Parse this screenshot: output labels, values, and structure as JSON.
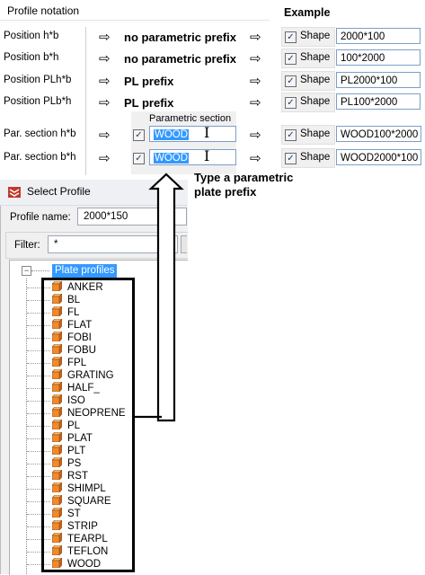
{
  "header": {
    "profile_notation": "Profile notation",
    "example": "Example"
  },
  "rows": [
    {
      "label": "Position h*b",
      "prefix": "no parametric prefix",
      "shape": "Shape",
      "value": "2000*100"
    },
    {
      "label": "Position b*h",
      "prefix": "no parametric prefix",
      "shape": "Shape",
      "value": "100*2000"
    },
    {
      "label": "Position PLh*b",
      "prefix": "PL prefix",
      "shape": "Shape",
      "value": "PL2000*100"
    },
    {
      "label": "Position PLb*h",
      "prefix": "PL prefix",
      "shape": "Shape",
      "value": "PL100*2000"
    },
    {
      "label": "Par. section h*b",
      "param": "WOOD",
      "shape": "Shape",
      "value": "WOOD100*2000"
    },
    {
      "label": "Par. section b*h",
      "param": "WOOD",
      "shape": "Shape",
      "value": "WOOD2000*100"
    }
  ],
  "parametric_section_title": "Parametric section",
  "callout": {
    "line1": "Type a parametric",
    "line2": "plate prefix"
  },
  "dialog": {
    "title": "Select Profile",
    "profile_name_label": "Profile name:",
    "profile_name_value": "2000*150",
    "filter_label": "Filter:",
    "filter_value": "*",
    "tree_root": "Plate profiles",
    "items": [
      "ANKER",
      "BL",
      "FL",
      "FLAT",
      "FOBI",
      "FOBU",
      "FPL",
      "GRATING",
      "HALF_",
      "ISO",
      "NEOPRENE",
      "PL",
      "PLAT",
      "PLT",
      "PS",
      "RST",
      "SHIMPL",
      "SQUARE",
      "ST",
      "STRIP",
      "TEARPL",
      "TEFLON",
      "WOOD"
    ]
  },
  "colors": {
    "selection": "#3399ff",
    "cube_orange": "#f08a2c",
    "textbox_border": "#7b9fc7"
  },
  "icons": {
    "arrow": "hollow-right-arrow",
    "checkbox": "checked",
    "cube": "profile-cube-icon",
    "text_cursor": "i-beam-cursor-icon"
  }
}
